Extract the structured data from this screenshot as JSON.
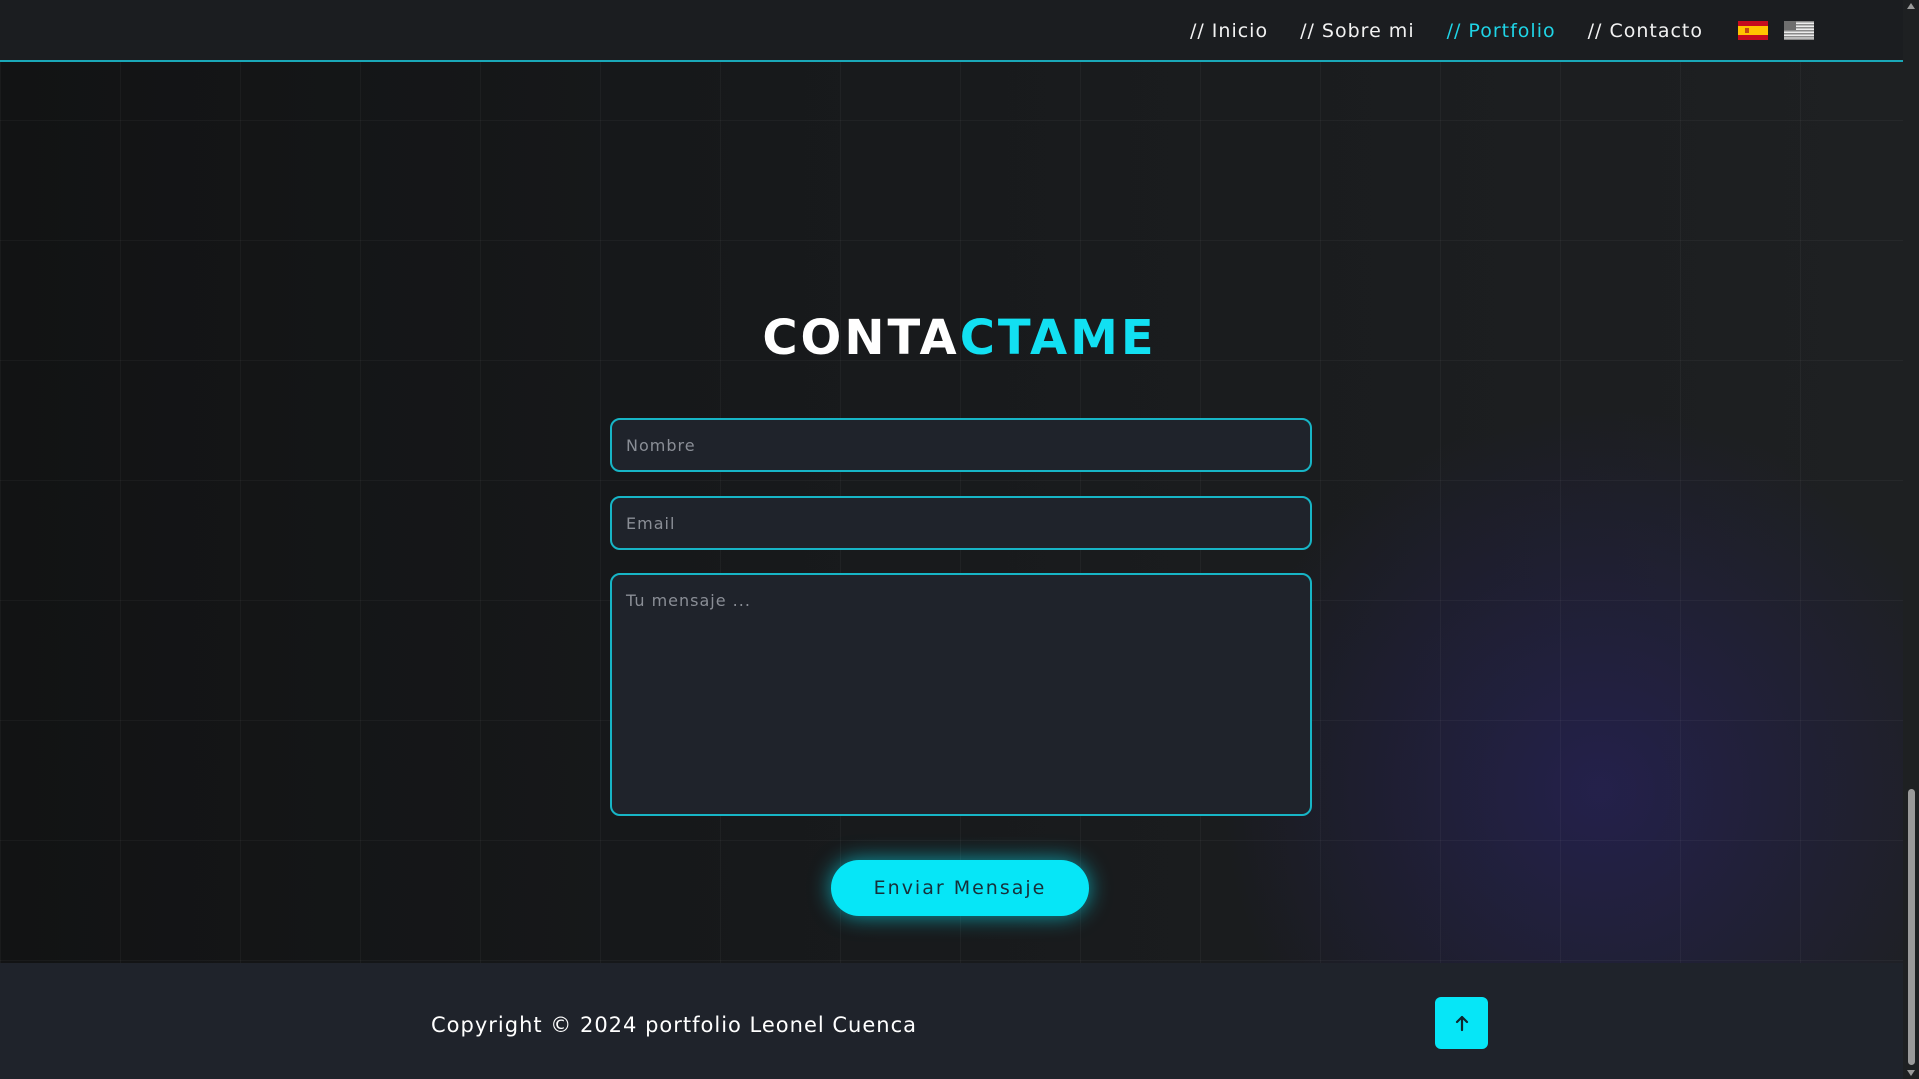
{
  "nav": {
    "links": [
      {
        "label": "// Inicio",
        "active": false
      },
      {
        "label": "// Sobre mi",
        "active": false
      },
      {
        "label": "// Portfolio",
        "active": true
      },
      {
        "label": "// Contacto",
        "active": false
      }
    ],
    "flags": [
      "spain-flag-icon",
      "usa-flag-icon"
    ]
  },
  "contact": {
    "title_white": "CONTA",
    "title_accent": "CTAME",
    "name_placeholder": "Nombre",
    "email_placeholder": "Email",
    "message_placeholder": "Tu mensaje ...",
    "submit_label": "Enviar Mensaje"
  },
  "footer": {
    "copyright": "Copyright © 2024 portfolio Leonel Cuenca",
    "back_to_top_icon": "arrow-up-icon"
  },
  "colors": {
    "accent": "#06e6f7",
    "accent_border": "#17b5c6",
    "navbar_bg": "#1b1d20",
    "footer_bg": "#1f232b",
    "input_bg": "#1f232b"
  }
}
